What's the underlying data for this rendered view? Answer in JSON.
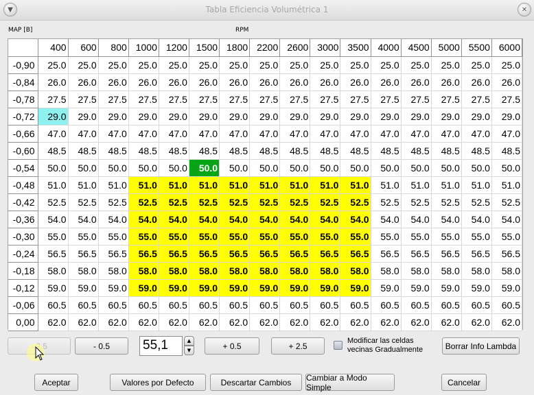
{
  "window": {
    "title": "Tabla Eficiencia Volumétrica 1"
  },
  "axes": {
    "map_label": "MAP [B]",
    "rpm_label": "RPM"
  },
  "table": {
    "columns": [
      "400",
      "600",
      "800",
      "1000",
      "1200",
      "1500",
      "1800",
      "2200",
      "2600",
      "3000",
      "3500",
      "4000",
      "4500",
      "5000",
      "5500",
      "6000"
    ],
    "rows": [
      {
        "map": "-0,90",
        "values": [
          "25.0",
          "25.0",
          "25.0",
          "25.0",
          "25.0",
          "25.0",
          "25.0",
          "25.0",
          "25.0",
          "25.0",
          "25.0",
          "25.0",
          "25.0",
          "25.0",
          "25.0",
          "25.0"
        ]
      },
      {
        "map": "-0,84",
        "values": [
          "26.0",
          "26.0",
          "26.0",
          "26.0",
          "26.0",
          "26.0",
          "26.0",
          "26.0",
          "26.0",
          "26.0",
          "26.0",
          "26.0",
          "26.0",
          "26.0",
          "26.0",
          "26.0"
        ]
      },
      {
        "map": "-0,78",
        "values": [
          "27.5",
          "27.5",
          "27.5",
          "27.5",
          "27.5",
          "27.5",
          "27.5",
          "27.5",
          "27.5",
          "27.5",
          "27.5",
          "27.5",
          "27.5",
          "27.5",
          "27.5",
          "27.5"
        ]
      },
      {
        "map": "-0,72",
        "values": [
          "29.0",
          "29.0",
          "29.0",
          "29.0",
          "29.0",
          "29.0",
          "29.0",
          "29.0",
          "29.0",
          "29.0",
          "29.0",
          "29.0",
          "29.0",
          "29.0",
          "29.0",
          "29.0"
        ]
      },
      {
        "map": "-0,66",
        "values": [
          "47.0",
          "47.0",
          "47.0",
          "47.0",
          "47.0",
          "47.0",
          "47.0",
          "47.0",
          "47.0",
          "47.0",
          "47.0",
          "47.0",
          "47.0",
          "47.0",
          "47.0",
          "47.0"
        ]
      },
      {
        "map": "-0,60",
        "values": [
          "48.5",
          "48.5",
          "48.5",
          "48.5",
          "48.5",
          "48.5",
          "48.5",
          "48.5",
          "48.5",
          "48.5",
          "48.5",
          "48.5",
          "48.5",
          "48.5",
          "48.5",
          "48.5"
        ]
      },
      {
        "map": "-0,54",
        "values": [
          "50.0",
          "50.0",
          "50.0",
          "50.0",
          "50.0",
          "50.0",
          "50.0",
          "50.0",
          "50.0",
          "50.0",
          "50.0",
          "50.0",
          "50.0",
          "50.0",
          "50.0",
          "50.0"
        ]
      },
      {
        "map": "-0,48",
        "values": [
          "51.0",
          "51.0",
          "51.0",
          "51.0",
          "51.0",
          "51.0",
          "51.0",
          "51.0",
          "51.0",
          "51.0",
          "51.0",
          "51.0",
          "51.0",
          "51.0",
          "51.0",
          "51.0"
        ]
      },
      {
        "map": "-0,42",
        "values": [
          "52.5",
          "52.5",
          "52.5",
          "52.5",
          "52.5",
          "52.5",
          "52.5",
          "52.5",
          "52.5",
          "52.5",
          "52.5",
          "52.5",
          "52.5",
          "52.5",
          "52.5",
          "52.5"
        ]
      },
      {
        "map": "-0,36",
        "values": [
          "54.0",
          "54.0",
          "54.0",
          "54.0",
          "54.0",
          "54.0",
          "54.0",
          "54.0",
          "54.0",
          "54.0",
          "54.0",
          "54.0",
          "54.0",
          "54.0",
          "54.0",
          "54.0"
        ]
      },
      {
        "map": "-0,30",
        "values": [
          "55.0",
          "55.0",
          "55.0",
          "55.0",
          "55.0",
          "55.0",
          "55.0",
          "55.0",
          "55.0",
          "55.0",
          "55.0",
          "55.0",
          "55.0",
          "55.0",
          "55.0",
          "55.0"
        ]
      },
      {
        "map": "-0,24",
        "values": [
          "56.5",
          "56.5",
          "56.5",
          "56.5",
          "56.5",
          "56.5",
          "56.5",
          "56.5",
          "56.5",
          "56.5",
          "56.5",
          "56.5",
          "56.5",
          "56.5",
          "56.5",
          "56.5"
        ]
      },
      {
        "map": "-0,18",
        "values": [
          "58.0",
          "58.0",
          "58.0",
          "58.0",
          "58.0",
          "58.0",
          "58.0",
          "58.0",
          "58.0",
          "58.0",
          "58.0",
          "58.0",
          "58.0",
          "58.0",
          "58.0",
          "58.0"
        ]
      },
      {
        "map": "-0,12",
        "values": [
          "59.0",
          "59.0",
          "59.0",
          "59.0",
          "59.0",
          "59.0",
          "59.0",
          "59.0",
          "59.0",
          "59.0",
          "59.0",
          "59.0",
          "59.0",
          "59.0",
          "59.0",
          "59.0"
        ]
      },
      {
        "map": "-0,06",
        "values": [
          "60.5",
          "60.5",
          "60.5",
          "60.5",
          "60.5",
          "60.5",
          "60.5",
          "60.5",
          "60.5",
          "60.5",
          "60.5",
          "60.5",
          "60.5",
          "60.5",
          "60.5",
          "60.5"
        ]
      },
      {
        "map": "0,00",
        "values": [
          "62.0",
          "62.0",
          "62.0",
          "62.0",
          "62.0",
          "62.0",
          "62.0",
          "62.0",
          "62.0",
          "62.0",
          "62.0",
          "62.0",
          "62.0",
          "62.0",
          "62.0",
          "62.0"
        ]
      }
    ],
    "selection": {
      "rows": [
        7,
        13
      ],
      "cols": [
        3,
        10
      ],
      "color": "#ffff00"
    },
    "current_cell": {
      "row": 6,
      "col": 5,
      "color": "#05a515"
    },
    "highlight_cell": {
      "row": 3,
      "col": 0,
      "color": "#8ff0f0"
    }
  },
  "controls": {
    "minus_2_5": "- 2.5",
    "minus_0_5": "- 0.5",
    "value": "55,1",
    "plus_0_5": "+ 0.5",
    "plus_2_5": "+ 2.5",
    "checkbox_label": "Modificar las celdas vecinas Gradualmente",
    "checkbox_checked": false,
    "borrar_lambda": "Borrar Info Lambda"
  },
  "footer": {
    "aceptar": "Aceptar",
    "valores_defecto": "Valores por Defecto",
    "descartar": "Descartar Cambios",
    "modo_simple": "Cambiar a Modo Simple",
    "cancelar": "Cancelar"
  },
  "icons": {
    "window_menu": "chevron-down-icon",
    "window_close": "close-icon",
    "spin_up": "triangle-up-icon",
    "spin_down": "triangle-down-icon",
    "cursor": "mouse-pointer-icon"
  }
}
